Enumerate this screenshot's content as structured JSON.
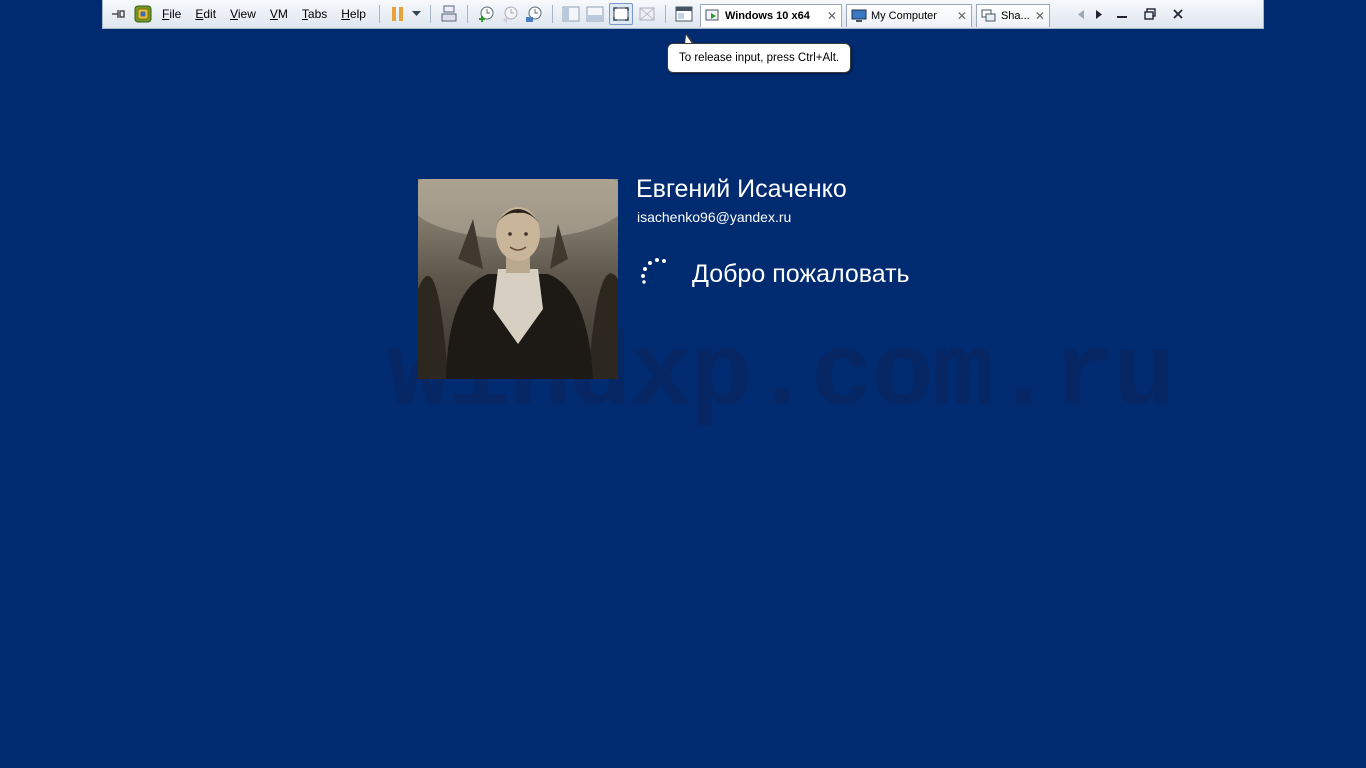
{
  "toolbar": {
    "menus": [
      "File",
      "Edit",
      "View",
      "VM",
      "Tabs",
      "Help"
    ],
    "tabs": [
      {
        "label": "Windows 10 x64",
        "active": true,
        "icon": "vm-running-icon"
      },
      {
        "label": "My Computer",
        "active": false,
        "icon": "computer-icon"
      },
      {
        "label": "Sha...",
        "active": false,
        "icon": "shared-vms-icon"
      }
    ],
    "close_glyph": "✕"
  },
  "tooltip": {
    "text": "To release input, press Ctrl+Alt."
  },
  "login": {
    "user_name": "Евгений Исаченко",
    "user_email": "isachenko96@yandex.ru",
    "status": "Добро пожаловать"
  },
  "watermark": {
    "text": "windxp.com.ru"
  },
  "colors": {
    "background": "#002b71",
    "toolbar": "#e6ecf4",
    "text": "#ffffff",
    "pause_accent": "#e8a23a"
  }
}
